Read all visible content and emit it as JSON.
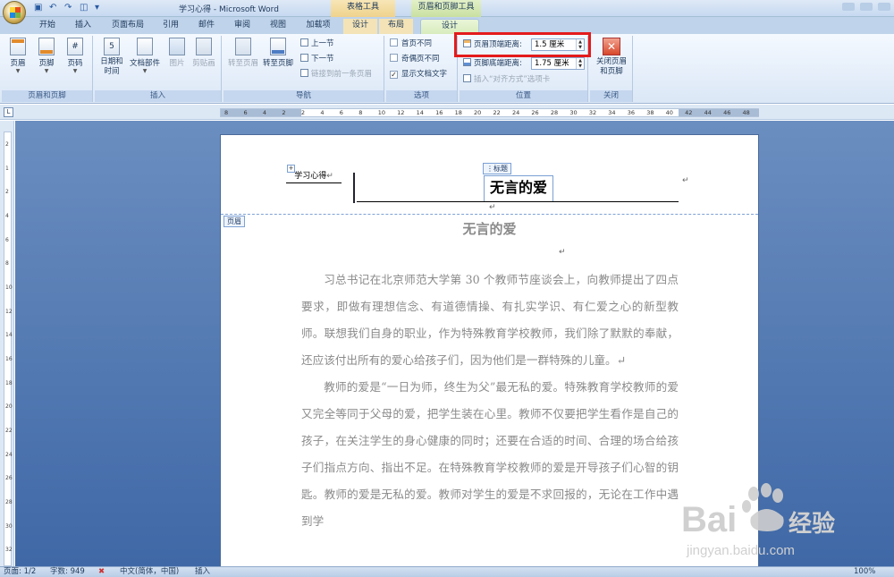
{
  "window": {
    "title": "学习心得 - Microsoft Word",
    "context_tool_table": "表格工具",
    "context_tool_header_footer": "页眉和页脚工具"
  },
  "tabs": [
    "开始",
    "插入",
    "页面布局",
    "引用",
    "邮件",
    "审阅",
    "视图",
    "加载项",
    "设计",
    "布局",
    "设计"
  ],
  "ribbon": {
    "group_header_footer": {
      "title": "页眉和页脚",
      "header": "页眉",
      "footer": "页脚",
      "page_number": "页码"
    },
    "group_insert": {
      "title": "插入",
      "date_time": "日期和\n时间",
      "quick_parts": "文档部件",
      "picture": "图片",
      "clip_art": "剪贴画"
    },
    "group_navigation": {
      "title": "导航",
      "goto_header": "转至页眉",
      "goto_footer": "转至页脚",
      "prev_section": "上一节",
      "next_section": "下一节",
      "link_previous": "链接到前一条页眉"
    },
    "group_options": {
      "title": "选项",
      "different_first_page": "首页不同",
      "different_odd_even": "奇偶页不同",
      "show_document_text": "显示文档文字",
      "show_document_text_checked": true
    },
    "group_position": {
      "title": "位置",
      "header_from_top_label": "页眉顶端距离:",
      "header_from_top_value": "1.5 厘米",
      "footer_from_bottom_label": "页脚底端距离:",
      "footer_from_bottom_value": "1.75 厘米",
      "insert_alignment_tab": "插入“对齐方式”选项卡"
    },
    "group_close": {
      "title": "关闭",
      "close_label": "关闭页眉\n和页脚"
    }
  },
  "ruler": {
    "ticks": [
      "8",
      "6",
      "4",
      "2",
      "2",
      "4",
      "6",
      "8",
      "10",
      "12",
      "14",
      "16",
      "18",
      "20",
      "22",
      "24",
      "26",
      "28",
      "30",
      "32",
      "34",
      "36",
      "38",
      "40",
      "42",
      "44",
      "46",
      "48"
    ]
  },
  "vruler": {
    "ticks": [
      "2",
      "1",
      "2",
      "4",
      "6",
      "8",
      "10",
      "12",
      "14",
      "16",
      "18",
      "20",
      "22",
      "24",
      "26",
      "28",
      "30",
      "32"
    ]
  },
  "document": {
    "header_left_text": "学习心得",
    "header_tag": "标题",
    "header_title": "无言的爱",
    "header_section_label": "页眉",
    "title": "无言的爱",
    "paragraphs": [
      "习总书记在北京师范大学第 30 个教师节座谈会上，向教师提出了四点要求，即做有理想信念、有道德情操、有扎实学识、有仁爱之心的新型教师。联想我们自身的职业，作为特殊教育学校教师，我们除了默默的奉献，还应该付出所有的爱心给孩子们，因为他们是一群特殊的儿童。↵",
      "教师的爱是“一日为师，终生为父”最无私的爱。特殊教育学校教师的爱又完全等同于父母的爱，把学生装在心里。教师不仅要把学生看作是自己的孩子，在关注学生的身心健康的同时；还要在合适的时间、合理的场合给孩子们指点方向、指出不足。在特殊教育学校教师的爱是开导孩子们心智的钥匙。教师的爱是无私的爱。教师对学生的爱是不求回报的，无论在工作中遇到学"
    ]
  },
  "status": {
    "page": "页面: 1/2",
    "word_count": "字数: 949",
    "language": "中文(简体，中国)",
    "mode": "插入",
    "zoom": "100%"
  },
  "watermark": {
    "brand": "Bai",
    "brand2": "经验",
    "url": "jingyan.baidu.com"
  },
  "colors": {
    "highlight": "#e31b1b",
    "ribbon_bg": "#dbe7f6",
    "workspace_bg": "#4a72ae"
  }
}
